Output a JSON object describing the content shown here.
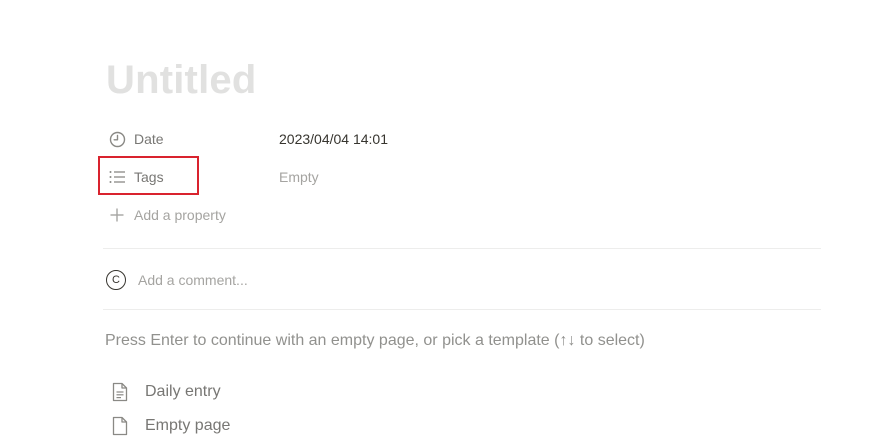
{
  "page": {
    "title_placeholder": "Untitled"
  },
  "properties": [
    {
      "icon": "clock-icon",
      "name": "Date",
      "value": "2023/04/04 14:01",
      "empty": false
    },
    {
      "icon": "list-icon",
      "name": "Tags",
      "value": "Empty",
      "empty": true
    }
  ],
  "add_property_label": "Add a property",
  "comment": {
    "avatar_letter": "C",
    "placeholder": "Add a comment..."
  },
  "template_hint": "Press Enter to continue with an empty page, or pick a template (↑↓ to select)",
  "templates": [
    {
      "icon": "document-lines-icon",
      "label": "Daily entry"
    },
    {
      "icon": "document-icon",
      "label": "Empty page"
    }
  ],
  "colors": {
    "highlight": "#d9232e",
    "title_placeholder": "#e1e1e0",
    "muted_text": "#a5a4a1"
  }
}
